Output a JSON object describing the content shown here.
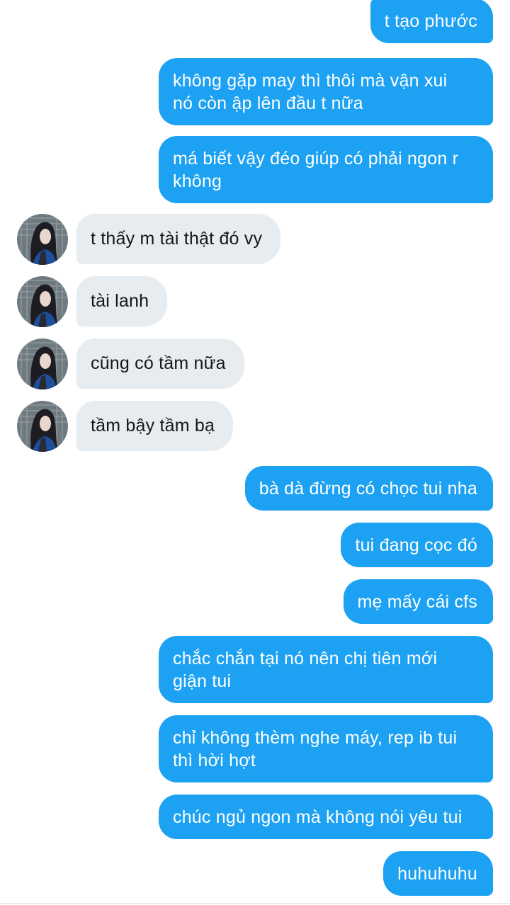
{
  "conversation": {
    "messages": [
      {
        "from": "me",
        "text": "t tạo phước"
      },
      {
        "from": "me",
        "text": "không gặp may thì thôi mà vận xui\nnó còn ập lên đầu t nữa"
      },
      {
        "from": "me",
        "text": "má biết vậy đéo giúp có phải ngon r\nkhông"
      },
      {
        "from": "them",
        "text": "t thấy m tài thật đó vy"
      },
      {
        "from": "them",
        "text": "tài lanh"
      },
      {
        "from": "them",
        "text": "cũng có tầm nữa"
      },
      {
        "from": "them",
        "text": "tầm bậy tầm bạ"
      },
      {
        "from": "me",
        "text": "bà dà đừng có chọc tui nha"
      },
      {
        "from": "me",
        "text": "tui đang cọc đó"
      },
      {
        "from": "me",
        "text": "mẹ mấy cái cfs"
      },
      {
        "from": "me",
        "text": "chắc chắn tại nó nên chị tiên mới\ngiận tui"
      },
      {
        "from": "me",
        "text": "chỉ không thèm nghe máy, rep ib tui\nthì hời hợt"
      },
      {
        "from": "me",
        "text": "chúc ngủ ngon mà không nói yêu tui"
      },
      {
        "from": "me",
        "text": "huhuhuhu"
      }
    ]
  },
  "colors": {
    "sent_bubble": "#1da1f2",
    "received_bubble": "#e6ecf0",
    "sent_text": "#ffffff",
    "received_text": "#14171a"
  },
  "icons": {
    "avatar": "contact-avatar-photo"
  }
}
